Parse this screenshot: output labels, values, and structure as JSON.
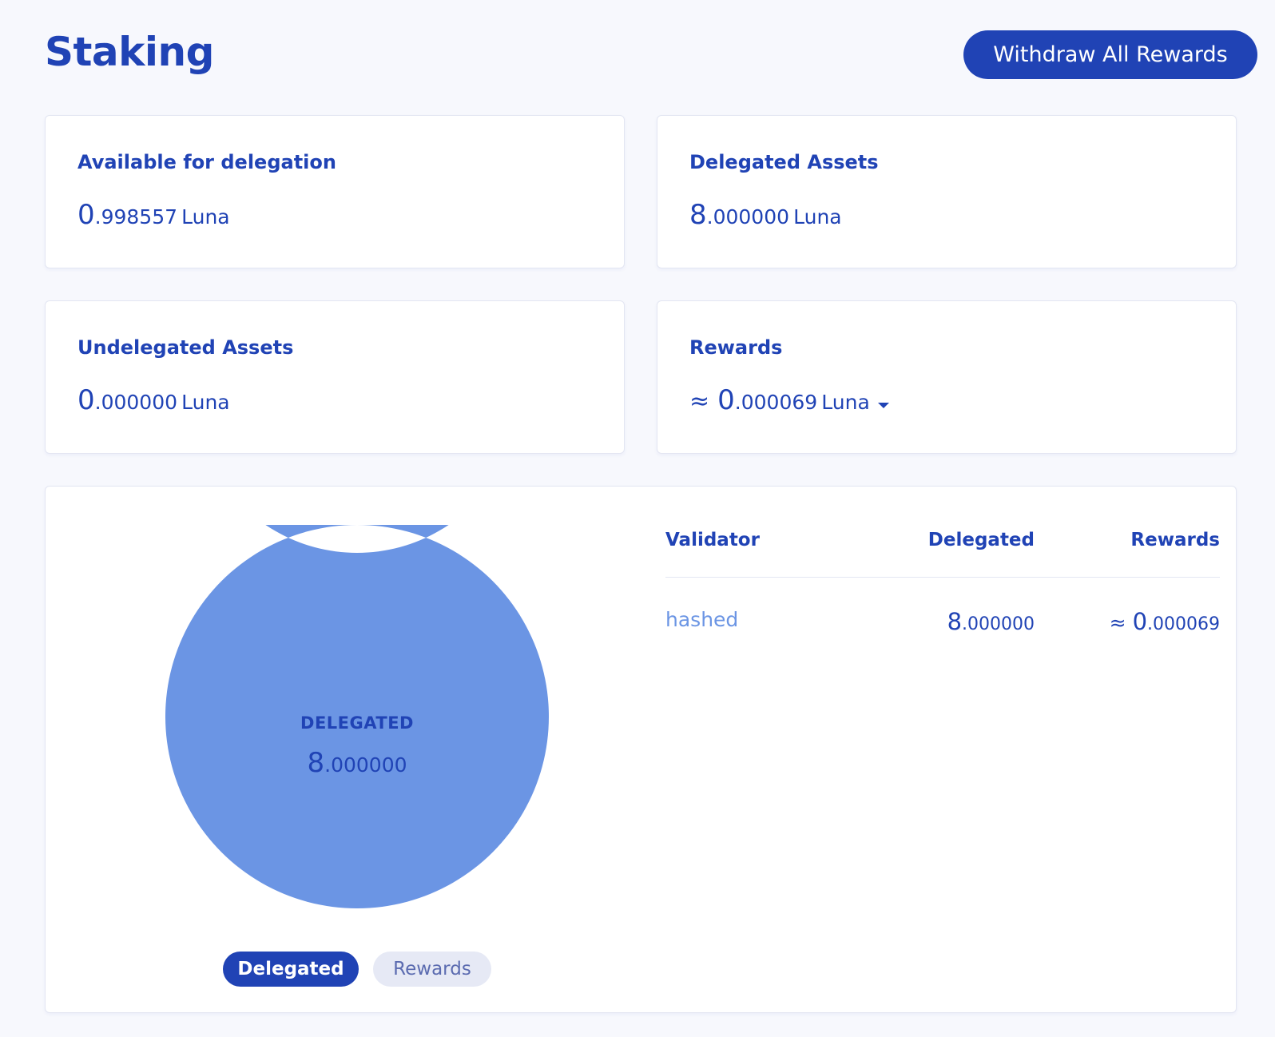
{
  "page": {
    "title": "Staking",
    "withdraw_label": "Withdraw All Rewards"
  },
  "cards": {
    "available": {
      "label": "Available for delegation",
      "int": "0",
      "dec": ".998557",
      "unit": "Luna"
    },
    "delegated": {
      "label": "Delegated Assets",
      "int": "8",
      "dec": ".000000",
      "unit": "Luna"
    },
    "undelegated": {
      "label": "Undelegated Assets",
      "int": "0",
      "dec": ".000000",
      "unit": "Luna"
    },
    "rewards": {
      "label": "Rewards",
      "approx": "≈",
      "int": "0",
      "dec": ".000069",
      "unit": "Luna"
    }
  },
  "chart_data": {
    "type": "pie",
    "categories": [
      "hashed"
    ],
    "values": [
      8.0
    ],
    "center_label": "DELEGATED",
    "center_int": "8",
    "center_dec": ".000000",
    "colors": [
      "#6b95e4"
    ]
  },
  "chart_toggle": {
    "delegated_label": "Delegated",
    "rewards_label": "Rewards",
    "selected": "Delegated"
  },
  "table": {
    "headers": {
      "validator": "Validator",
      "delegated": "Delegated",
      "rewards": "Rewards"
    },
    "rows": [
      {
        "validator": "hashed",
        "delegated_int": "8",
        "delegated_dec": ".000000",
        "rewards_approx": "≈",
        "rewards_int": "0",
        "rewards_dec": ".000069"
      }
    ]
  },
  "colors": {
    "primary": "#2043b5",
    "accent": "#6b95e4",
    "background": "#f7f8fd"
  }
}
